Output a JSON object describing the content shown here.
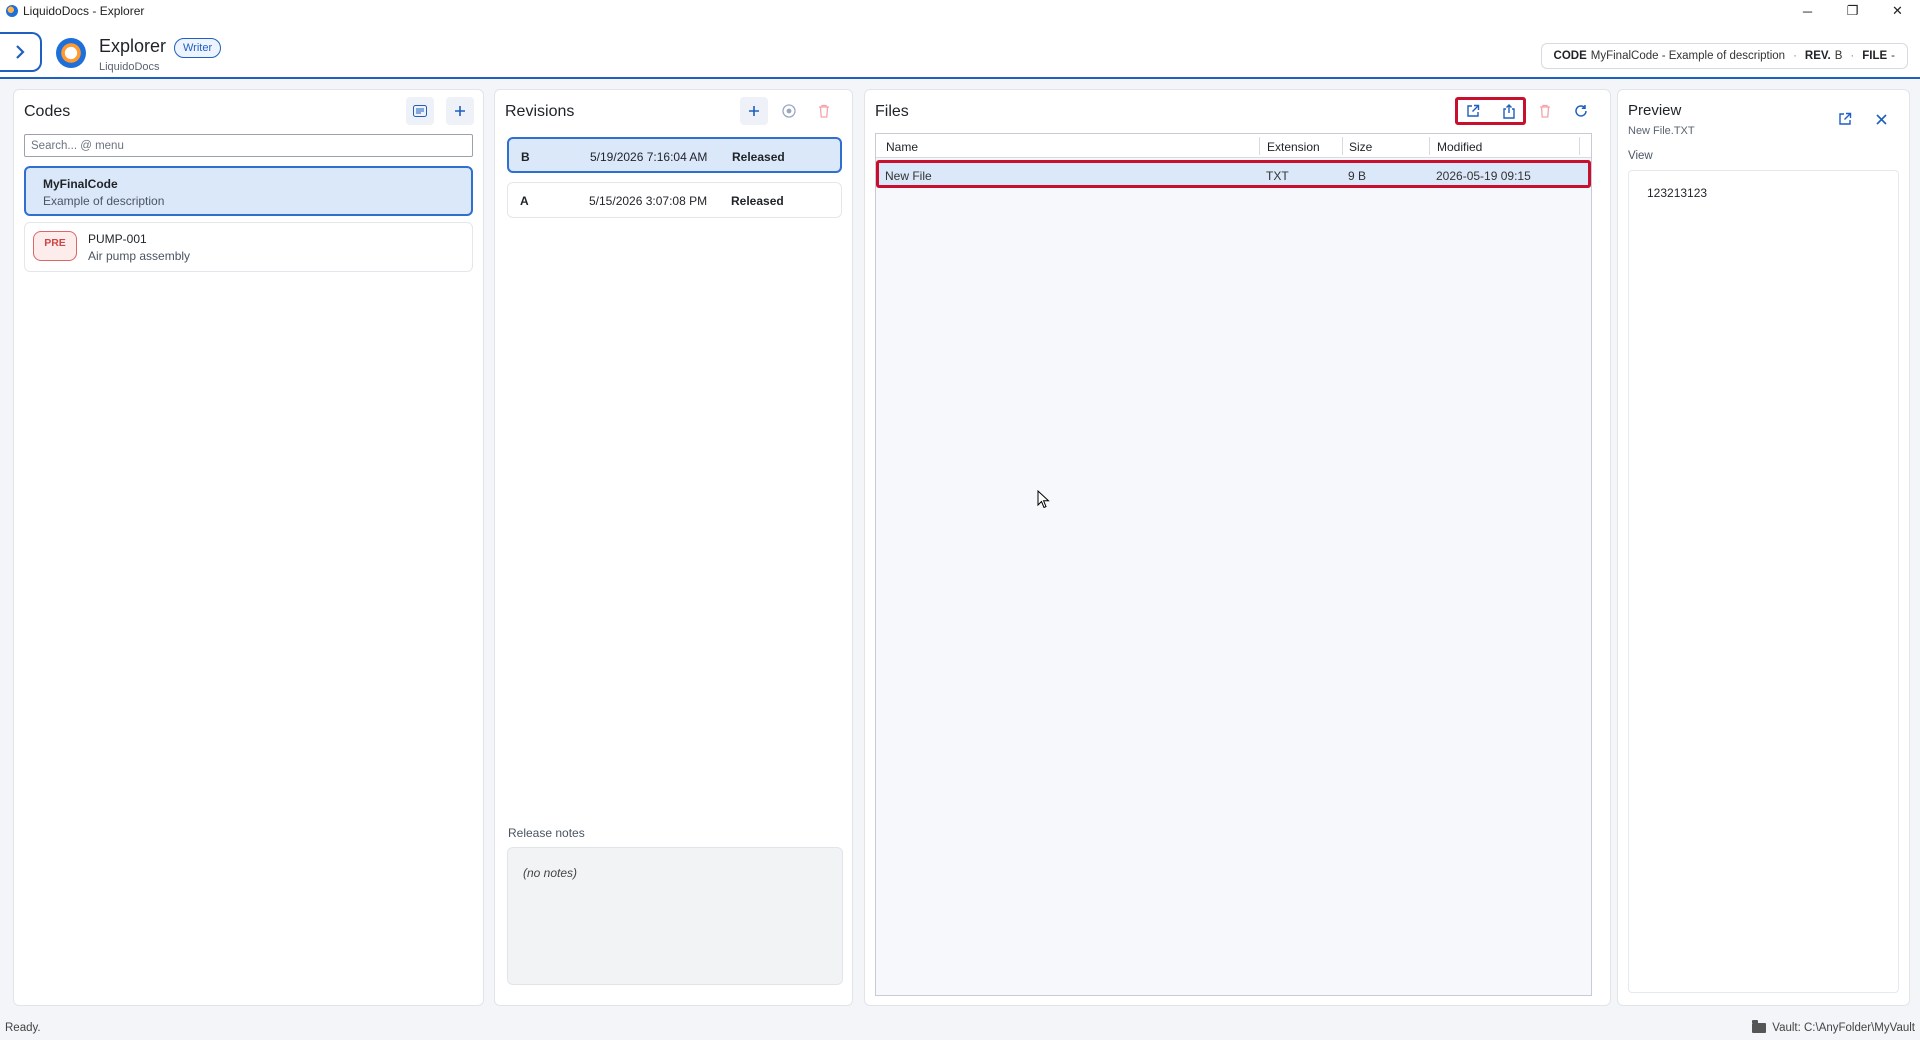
{
  "window": {
    "title": "LiquidoDocs - Explorer",
    "controls": [
      "─",
      "❐",
      "✕"
    ]
  },
  "header": {
    "app_name": "Explorer",
    "app_sub": "LiquidoDocs",
    "role_badge": "Writer",
    "context": {
      "code_label": "CODE",
      "code_value": "MyFinalCode - Example of description",
      "rev_label": "REV.",
      "rev_value": "B",
      "file_label": "FILE",
      "file_value": "-"
    }
  },
  "codes": {
    "title": "Codes",
    "search_placeholder": "Search... @ menu",
    "items": [
      {
        "name": "MyFinalCode",
        "desc": "Example of description",
        "selected": true
      },
      {
        "name": "PUMP-001",
        "desc": "Air pump assembly",
        "badge": "PRE"
      }
    ]
  },
  "revisions": {
    "title": "Revisions",
    "items": [
      {
        "letter": "B",
        "date": "5/19/2026 7:16:04 AM",
        "status": "Released",
        "selected": true
      },
      {
        "letter": "A",
        "date": "5/15/2026 3:07:08 PM",
        "status": "Released"
      }
    ],
    "notes_label": "Release notes",
    "notes_value": "(no notes)"
  },
  "files": {
    "title": "Files",
    "columns": [
      "Name",
      "Extension",
      "Size",
      "Modified"
    ],
    "rows": [
      {
        "name": "New File",
        "extension": "TXT",
        "size": "9 B",
        "modified": "2026-05-19 09:15"
      }
    ]
  },
  "preview": {
    "title": "Preview",
    "file_name": "New File.TXT",
    "view_label": "View",
    "content": "123213123"
  },
  "status": {
    "left": "Ready.",
    "vault": "Vault: C:\\AnyFolder\\MyVault"
  },
  "colors": {
    "accent": "#1e5fbf",
    "selection": "#dbe8f9",
    "highlight": "#c8102e",
    "danger": "#f3a3a8"
  },
  "icons": {
    "nav_toggle": "chevron-right-icon",
    "codes_list": "list-icon",
    "add": "plus-icon",
    "release": "target-icon",
    "delete": "trash-icon",
    "open_external": "open-external-icon",
    "export": "share-icon",
    "refresh": "refresh-icon",
    "close": "close-icon",
    "vault": "folder-icon"
  }
}
